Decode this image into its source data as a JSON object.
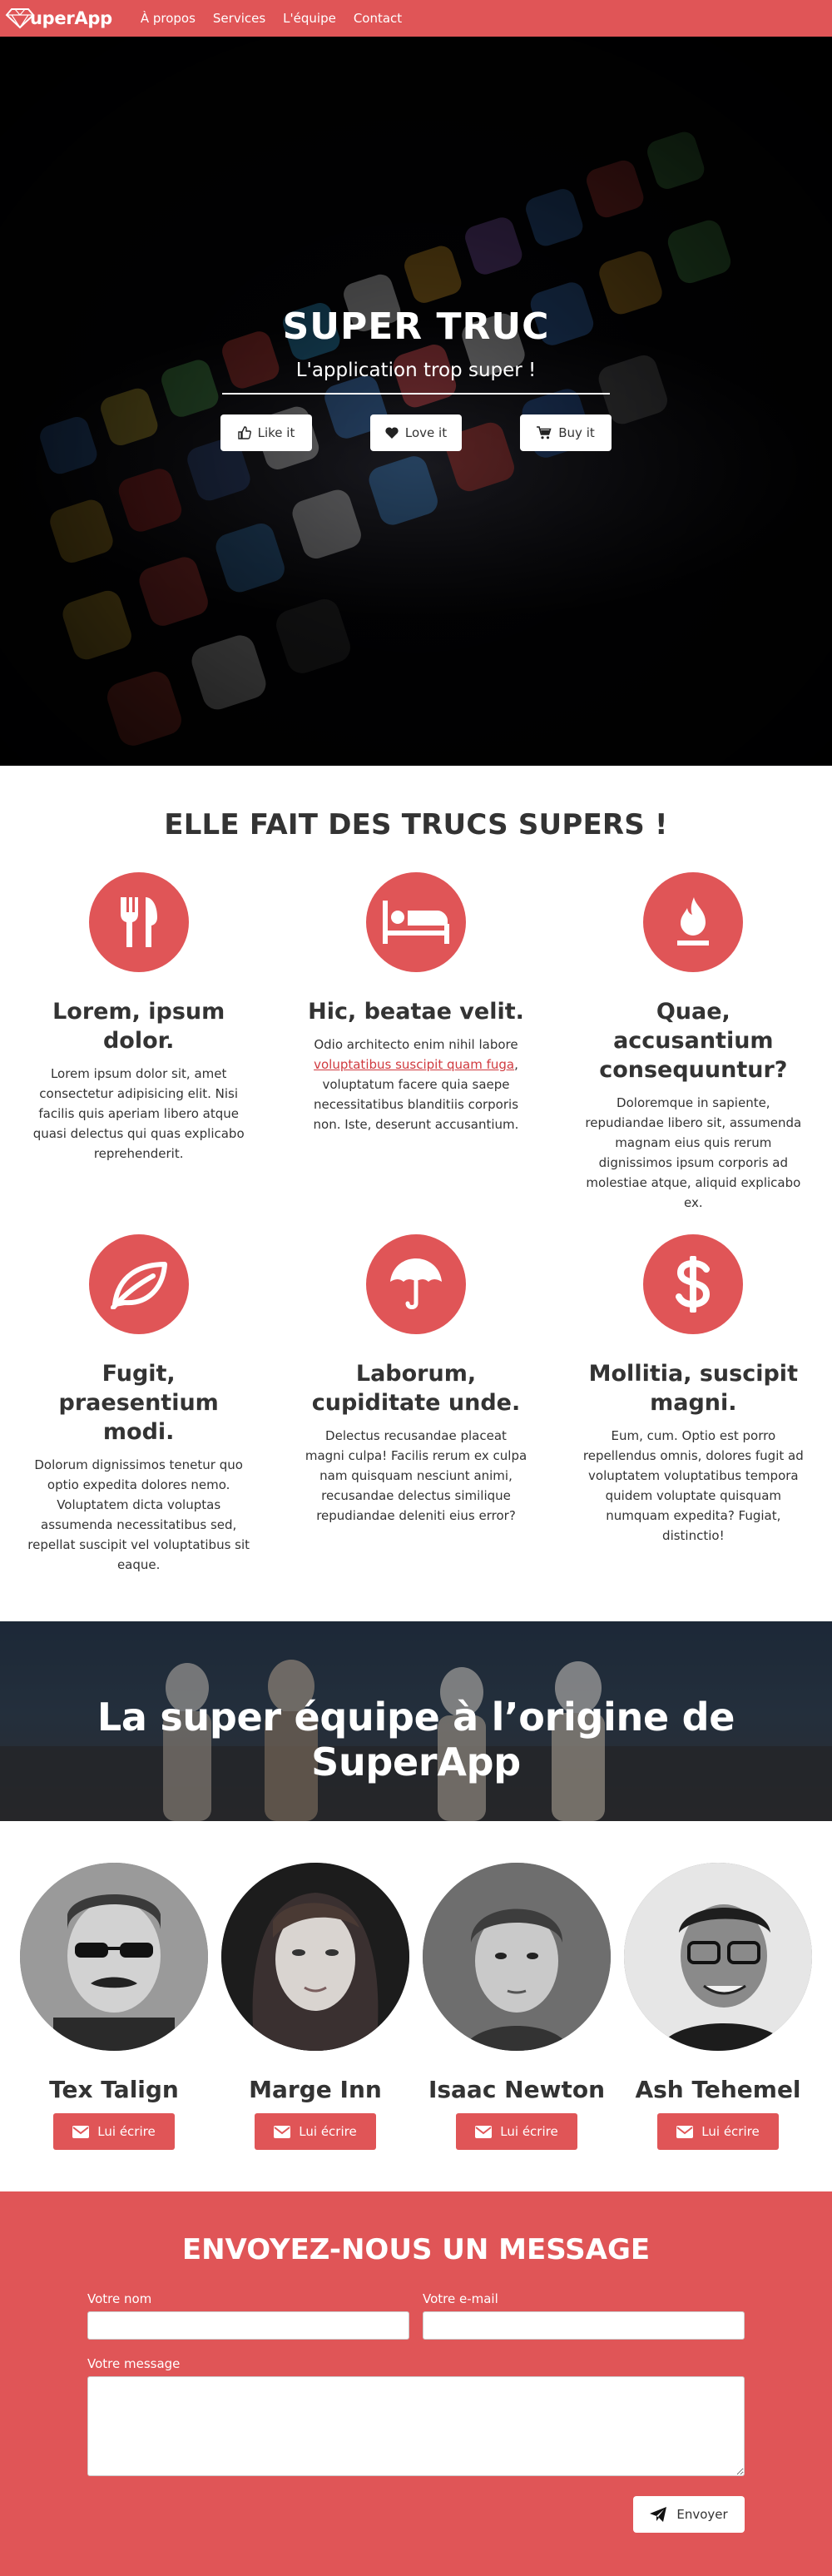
{
  "brand": {
    "name": "uperApp",
    "logo_icon": "diamond-logo-icon",
    "accent_color": "#e05557"
  },
  "nav": {
    "items": [
      {
        "label": "À propos"
      },
      {
        "label": "Services"
      },
      {
        "label": "L'équipe"
      },
      {
        "label": "Contact"
      }
    ]
  },
  "hero": {
    "title": "SUPER TRUC",
    "subtitle": "L'application trop super !",
    "buttons": [
      {
        "label": "Like it",
        "icon": "thumbs-up-icon"
      },
      {
        "label": "Love it",
        "icon": "heart-icon"
      },
      {
        "label": "Buy it",
        "icon": "shopping-cart-icon"
      }
    ]
  },
  "features": {
    "title": "ELLE FAIT DES TRUCS SUPERS !",
    "items": [
      {
        "icon": "cutlery-icon",
        "title": "Lorem, ipsum dolor.",
        "text": "Lorem ipsum dolor sit, amet consectetur adipisicing elit. Nisi facilis quis aperiam libero atque quasi delectus qui quas explicabo reprehenderit."
      },
      {
        "icon": "bed-icon",
        "title": "Hic, beatae velit.",
        "text_before": "Odio architecto enim nihil labore ",
        "link": "voluptatibus suscipit quam fuga",
        "text_after": ", voluptatum facere quia saepe necessitatibus blanditiis corporis non. Iste, deserunt accusantium."
      },
      {
        "icon": "fire-icon",
        "title": "Quae, accusantium consequuntur?",
        "text": "Doloremque in sapiente, repudiandae libero sit, assumenda magnam eius quis rerum dignissimos ipsum corporis ad molestiae atque, aliquid explicabo ex."
      },
      {
        "icon": "leaf-icon",
        "title": "Fugit, praesentium modi.",
        "text": "Dolorum dignissimos tenetur quo optio expedita dolores nemo. Voluptatem dicta voluptas assumenda necessitatibus sed, repellat suscipit vel voluptatibus sit eaque."
      },
      {
        "icon": "umbrella-icon",
        "title": "Laborum, cupiditate unde.",
        "text": "Delectus recusandae placeat magni culpa! Facilis rerum ex culpa nam quisquam nesciunt animi, recusandae delectus similique repudiandae deleniti eius error?"
      },
      {
        "icon": "dollar-icon",
        "title": "Mollitia, suscipit magni.",
        "text": "Eum, cum. Optio est porro repellendus omnis, dolores fugit ad voluptatem voluptatibus tempora quidem voluptate quisquam numquam expedita? Fugiat, distinctio!"
      }
    ]
  },
  "team": {
    "banner_title": "La super équipe à l’origine de SuperApp",
    "members": [
      {
        "name": "Tex Talign",
        "button": "Lui écrire"
      },
      {
        "name": "Marge Inn",
        "button": "Lui écrire"
      },
      {
        "name": "Isaac Newton",
        "button": "Lui écrire"
      },
      {
        "name": "Ash Tehemel",
        "button": "Lui écrire"
      }
    ]
  },
  "contact": {
    "title": "ENVOYEZ-NOUS UN MESSAGE",
    "name_label": "Votre nom",
    "name_value": "",
    "email_label": "Votre e-mail",
    "email_value": "",
    "message_label": "Votre message",
    "message_value": "",
    "submit": "Envoyer"
  }
}
